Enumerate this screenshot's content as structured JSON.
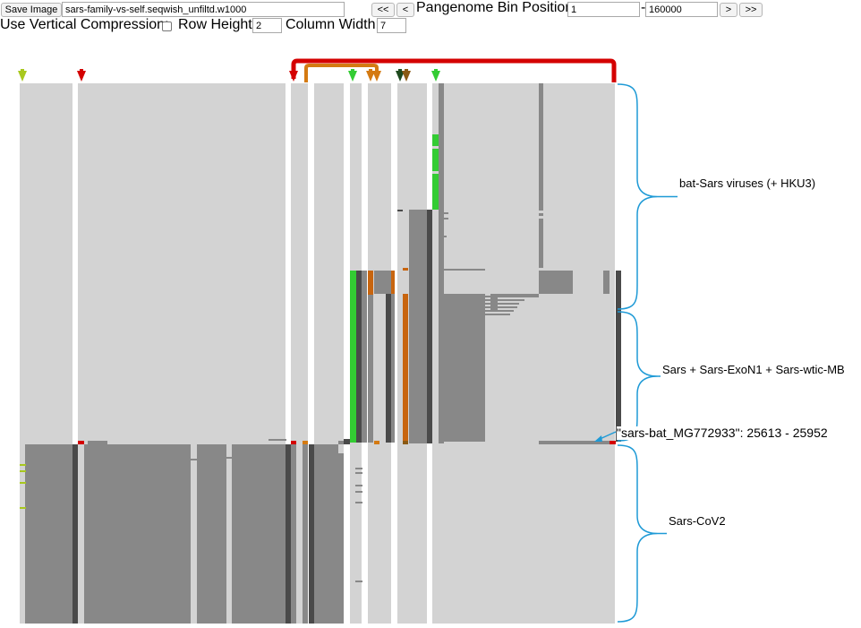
{
  "toolbar": {
    "save_image_label": "Save Image",
    "dataset_value": "sars-family-vs-self.seqwish_unfiltd.w1000",
    "first_label": "<<",
    "prev_label": "<",
    "bin_position_label": "Pangenome Bin Position:",
    "bin_start_value": "1",
    "range_separator": "-",
    "bin_end_value": "160000",
    "next_label": ">",
    "last_label": ">>",
    "vertical_compression_label": "Use Vertical Compression:",
    "vertical_compression_checked": false,
    "row_height_label": "Row Height:",
    "row_height_value": "2",
    "column_width_label": "Column Width:",
    "column_width_value": "7"
  },
  "annotations": {
    "group_1": "bat-Sars viruses (+ HKU3)",
    "group_2": "Sars + Sars-ExoN1 + Sars-wtic-MB",
    "group_3": "Sars-CoV2",
    "tooltip": "\"sars-bat_MG772933\": 25613 - 25952"
  },
  "colors": {
    "canvas_background": "#ffffff",
    "cell_light": "#d3d3d3",
    "cell_mid": "#888888",
    "cell_dark": "#4a4a4a",
    "link_red": "#d40000",
    "link_orange": "#d47a12",
    "link_green": "#33cc33",
    "link_yellow_green": "#a8c81e",
    "link_brown": "#8a5a14",
    "link_dark_green": "#1e4a1e",
    "highlight_green": "#33cc33",
    "highlight_orange": "#c8650f",
    "brace_blue": "#1e9ad6"
  }
}
